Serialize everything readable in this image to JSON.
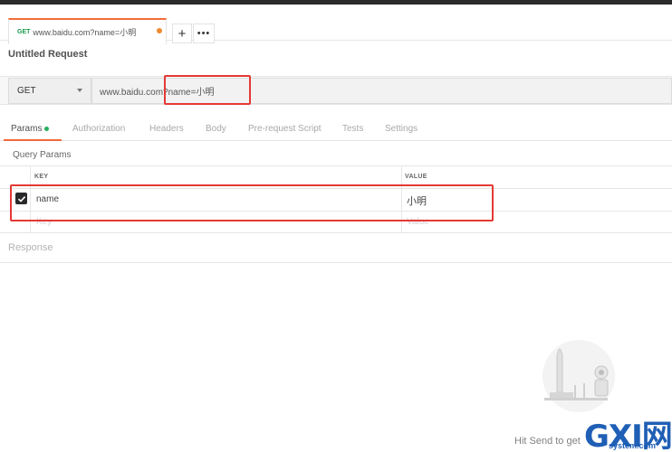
{
  "request_tab": {
    "method": "GET",
    "title": "www.baidu.com?name=小明"
  },
  "tab_actions": {
    "new_tab": "+",
    "more": "•••"
  },
  "request_name": "Untitled Request",
  "url_bar": {
    "method": "GET",
    "url": "www.baidu.com?name=小明"
  },
  "sub_tabs": [
    {
      "label": "Params"
    },
    {
      "label": "Authorization"
    },
    {
      "label": "Headers"
    },
    {
      "label": "Body"
    },
    {
      "label": "Pre-request Script"
    },
    {
      "label": "Tests"
    },
    {
      "label": "Settings"
    }
  ],
  "query_params": {
    "title": "Query Params",
    "columns": {
      "key": "KEY",
      "value": "VALUE"
    },
    "rows": [
      {
        "checked": true,
        "key": "name",
        "value": "小明"
      }
    ],
    "placeholder": {
      "key": "Key",
      "value": "Value"
    }
  },
  "response": {
    "label": "Response",
    "hint": "Hit Send to get"
  },
  "watermark": {
    "letters": "GXI网",
    "domain": "system.com"
  },
  "colors": {
    "accent": "#f26b3a",
    "method_green": "#1a9b4b",
    "annotation_red": "#e53935",
    "watermark_blue": "#1f5fb5"
  }
}
